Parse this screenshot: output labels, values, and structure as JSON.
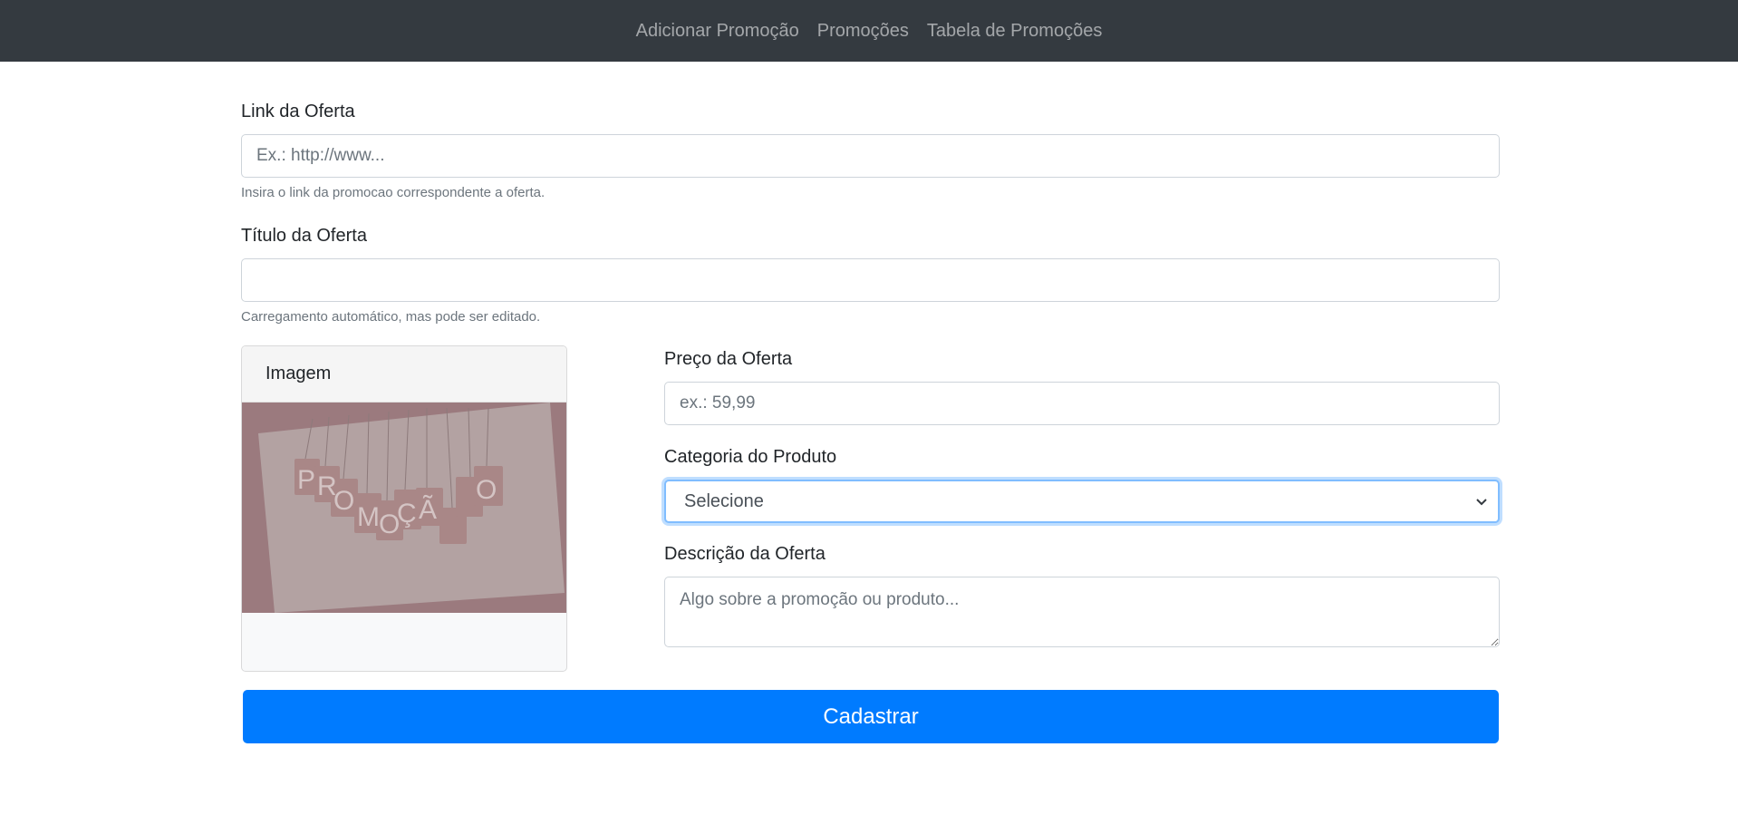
{
  "nav": {
    "items": [
      "Adicionar Promoção",
      "Promoções",
      "Tabela de Promoções"
    ]
  },
  "form": {
    "link": {
      "label": "Link da Oferta",
      "placeholder": "Ex.: http://www...",
      "value": "",
      "help": "Insira o link da promocao correspondente a oferta."
    },
    "title": {
      "label": "Título da Oferta",
      "value": "",
      "help": "Carregamento automático, mas pode ser editado."
    },
    "image": {
      "header": "Imagem",
      "alt_text": "PROMOÇÃO",
      "overlay_color": "#9b7a7e"
    },
    "price": {
      "label": "Preço da Oferta",
      "placeholder": "ex.: 59,99",
      "value": ""
    },
    "category": {
      "label": "Categoria do Produto",
      "selected": "Selecione",
      "icon": "chevron-down-icon"
    },
    "description": {
      "label": "Descrição da Oferta",
      "placeholder": "Algo sobre a promoção ou produto...",
      "value": ""
    },
    "submit_label": "Cadastrar"
  },
  "colors": {
    "navbar_bg": "#343a40",
    "primary": "#007bff",
    "focus_border": "#80bdff"
  }
}
